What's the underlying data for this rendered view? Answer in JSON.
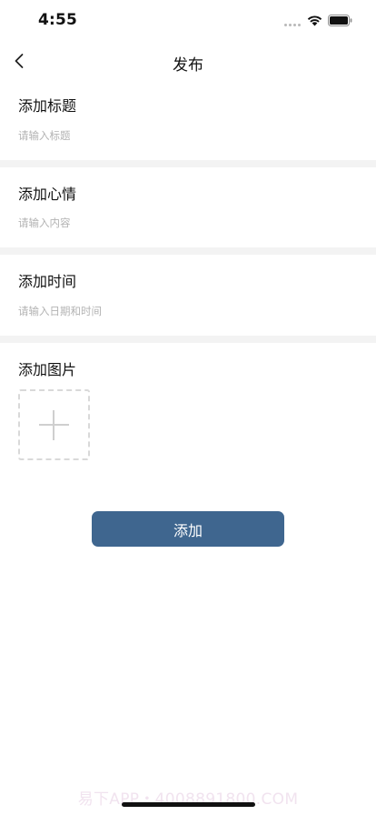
{
  "status_bar": {
    "time": "4:55"
  },
  "nav": {
    "title": "发布"
  },
  "sections": {
    "title": {
      "label": "添加标题",
      "placeholder": "请输入标题"
    },
    "mood": {
      "label": "添加心情",
      "placeholder": "请输入内容"
    },
    "time": {
      "label": "添加时间",
      "placeholder": "请输入日期和时间"
    },
    "image": {
      "label": "添加图片"
    }
  },
  "actions": {
    "add_label": "添加"
  },
  "watermark": "易下APP・4008891800.COM",
  "colors": {
    "accent": "#3f668f",
    "divider": "#f3f3f3",
    "placeholder": "#b3b3b3",
    "dashed_border": "#d9d9d9"
  },
  "icons": {
    "back": "chevron-left-icon",
    "upload": "plus-icon",
    "signal": "signal-icon",
    "wifi": "wifi-icon",
    "battery": "battery-icon"
  }
}
